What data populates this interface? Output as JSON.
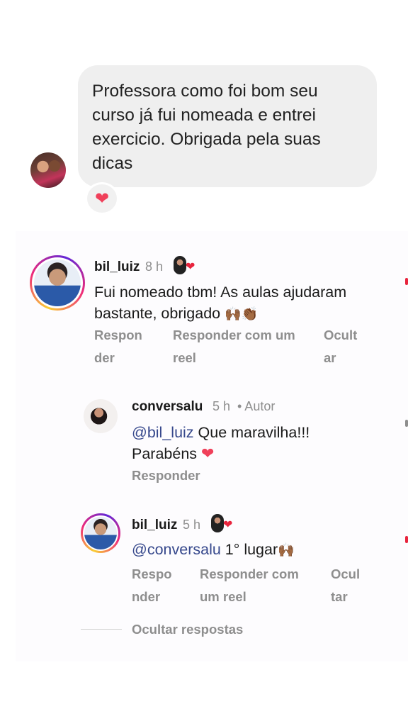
{
  "message": {
    "text": "Professora como foi bom seu curso já fui nomeada e entrei exercicio. Obrigada pela suas dicas",
    "reaction": "❤"
  },
  "comments": [
    {
      "username": "bil_luiz",
      "time": "8 h",
      "badge_heart": "❤",
      "text": "Fui nomeado tbm! As aulas ajudaram bastante, obrigado",
      "emoji": "🙌🏾👏🏾",
      "actions": {
        "reply": "Respon\nder",
        "reply_reel": "Responder com um\nreel",
        "hide": "Ocult\nar"
      }
    }
  ],
  "replies": [
    {
      "username": "conversalu",
      "time": "5 h",
      "author_tag": "• Autor",
      "mention": "@bil_luiz",
      "text": " Que maravilha!!!",
      "text_line2": "Parabéns",
      "heart": "❤",
      "action_reply": "Responder"
    },
    {
      "username": "bil_luiz",
      "time": "5 h",
      "badge_heart": "❤",
      "mention": "@conversalu",
      "text": " 1° lugar",
      "emoji": "🙌🏾",
      "actions": {
        "reply": "Respo\nnder",
        "reply_reel": "Responder com\num reel",
        "hide": "Ocul\ntar"
      }
    }
  ],
  "hide_replies": "Ocultar respostas",
  "colors": {
    "accent_red": "#e8243d",
    "mention": "#36488c",
    "muted": "#8e8e8e"
  }
}
